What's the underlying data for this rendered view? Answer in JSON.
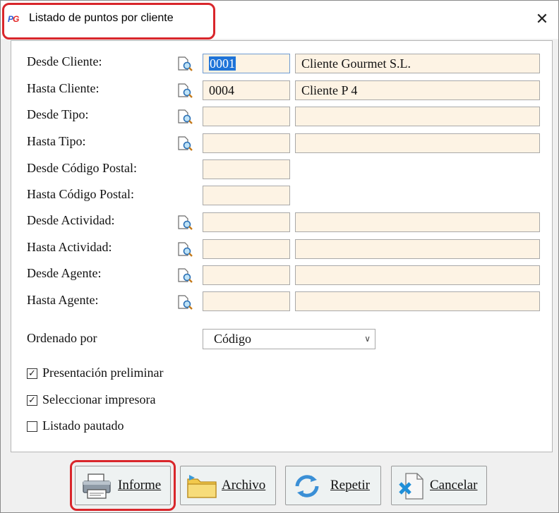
{
  "window": {
    "title": "Listado de puntos por cliente",
    "icon": "pg-app-icon",
    "icon_text_a": "P",
    "icon_text_b": "G",
    "close": "✕"
  },
  "form": {
    "rows": [
      {
        "label": "Desde Cliente:",
        "code": "0001",
        "desc": "Cliente Gourmet S.L.",
        "lookup": true
      },
      {
        "label": "Hasta Cliente:",
        "code": "0004",
        "desc": "Cliente P 4",
        "lookup": true
      },
      {
        "label": "Desde Tipo:",
        "code": "",
        "desc": "",
        "lookup": true
      },
      {
        "label": "Hasta Tipo:",
        "code": "",
        "desc": "",
        "lookup": true
      },
      {
        "label": "Desde Código Postal:",
        "code": "",
        "lookup": false
      },
      {
        "label": "Hasta Código Postal:",
        "code": "",
        "lookup": false
      },
      {
        "label": "Desde Actividad:",
        "code": "",
        "desc": "",
        "lookup": true
      },
      {
        "label": "Hasta Actividad:",
        "code": "",
        "desc": "",
        "lookup": true
      },
      {
        "label": "Desde Agente:",
        "code": "",
        "desc": "",
        "lookup": true
      },
      {
        "label": "Hasta Agente:",
        "code": "",
        "desc": "",
        "lookup": true
      }
    ],
    "order_label": "Ordenado por",
    "order_value": "Código",
    "checks": [
      {
        "label": "Presentación preliminar",
        "checked": true
      },
      {
        "label": "Seleccionar impresora",
        "checked": true
      },
      {
        "label": "Listado pautado",
        "checked": false
      }
    ]
  },
  "buttons": {
    "informe": "Informe",
    "archivo": "Archivo",
    "repetir": "Repetir",
    "cancelar": "Cancelar"
  },
  "colors": {
    "field_bg": "#fdf3e4",
    "highlight": "#d9262b",
    "selection": "#1e73d8"
  }
}
